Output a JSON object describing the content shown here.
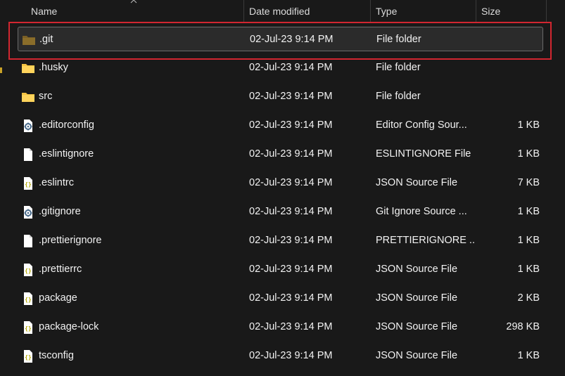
{
  "columns": {
    "name": "Name",
    "date": "Date modified",
    "type": "Type",
    "size": "Size"
  },
  "files": [
    {
      "name": ".git",
      "date": "02-Jul-23 9:14 PM",
      "type": "File folder",
      "size": "",
      "icon": "folder-dim-icon",
      "selected": true
    },
    {
      "name": ".husky",
      "date": "02-Jul-23 9:14 PM",
      "type": "File folder",
      "size": "",
      "icon": "folder-icon"
    },
    {
      "name": "src",
      "date": "02-Jul-23 9:14 PM",
      "type": "File folder",
      "size": "",
      "icon": "folder-icon"
    },
    {
      "name": ".editorconfig",
      "date": "02-Jul-23 9:14 PM",
      "type": "Editor Config Sour...",
      "size": "1 KB",
      "icon": "config-file-icon"
    },
    {
      "name": ".eslintignore",
      "date": "02-Jul-23 9:14 PM",
      "type": "ESLINTIGNORE File",
      "size": "1 KB",
      "icon": "blank-file-icon"
    },
    {
      "name": ".eslintrc",
      "date": "02-Jul-23 9:14 PM",
      "type": "JSON Source File",
      "size": "7 KB",
      "icon": "json-file-icon"
    },
    {
      "name": ".gitignore",
      "date": "02-Jul-23 9:14 PM",
      "type": "Git Ignore Source ...",
      "size": "1 KB",
      "icon": "config-file-icon"
    },
    {
      "name": ".prettierignore",
      "date": "02-Jul-23 9:14 PM",
      "type": "PRETTIERIGNORE ...",
      "size": "1 KB",
      "icon": "blank-file-icon"
    },
    {
      "name": ".prettierrc",
      "date": "02-Jul-23 9:14 PM",
      "type": "JSON Source File",
      "size": "1 KB",
      "icon": "json-file-icon"
    },
    {
      "name": "package",
      "date": "02-Jul-23 9:14 PM",
      "type": "JSON Source File",
      "size": "2 KB",
      "icon": "json-file-icon"
    },
    {
      "name": "package-lock",
      "date": "02-Jul-23 9:14 PM",
      "type": "JSON Source File",
      "size": "298 KB",
      "icon": "json-file-icon"
    },
    {
      "name": "tsconfig",
      "date": "02-Jul-23 9:14 PM",
      "type": "JSON Source File",
      "size": "1 KB",
      "icon": "json-file-icon"
    }
  ],
  "colors": {
    "background": "#191919",
    "highlight_border": "#d22630",
    "folder": "#f5c342",
    "folder_dim": "#8a6d2a"
  }
}
